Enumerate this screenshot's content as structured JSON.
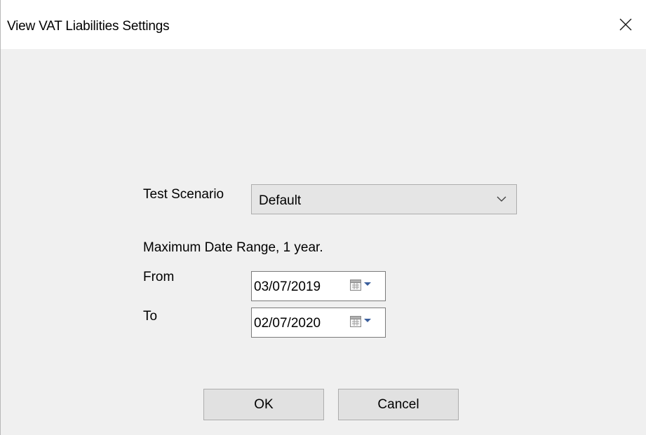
{
  "window": {
    "title": "View VAT Liabilities Settings",
    "close_glyph": "×"
  },
  "form": {
    "scenario_label": "Test Scenario",
    "scenario_value": "Default",
    "date_range_note": "Maximum Date Range, 1 year.",
    "from_label": "From",
    "from_value": "03/07/2019",
    "to_label": "To",
    "to_value": "02/07/2020"
  },
  "buttons": {
    "ok_label": "OK",
    "cancel_label": "Cancel"
  },
  "icons": {
    "close": "close-icon",
    "combo_arrow": "chevron-down-icon",
    "calendar": "calendar-icon",
    "dropdown": "triangle-down-icon"
  },
  "colors": {
    "dialog_background": "#f0f0f0",
    "titlebar_background": "#ffffff",
    "button_background": "#e1e1e1",
    "combo_background": "#e5e5e5",
    "border": "#adadad",
    "calendar_arrow": "#3a5e9c"
  }
}
